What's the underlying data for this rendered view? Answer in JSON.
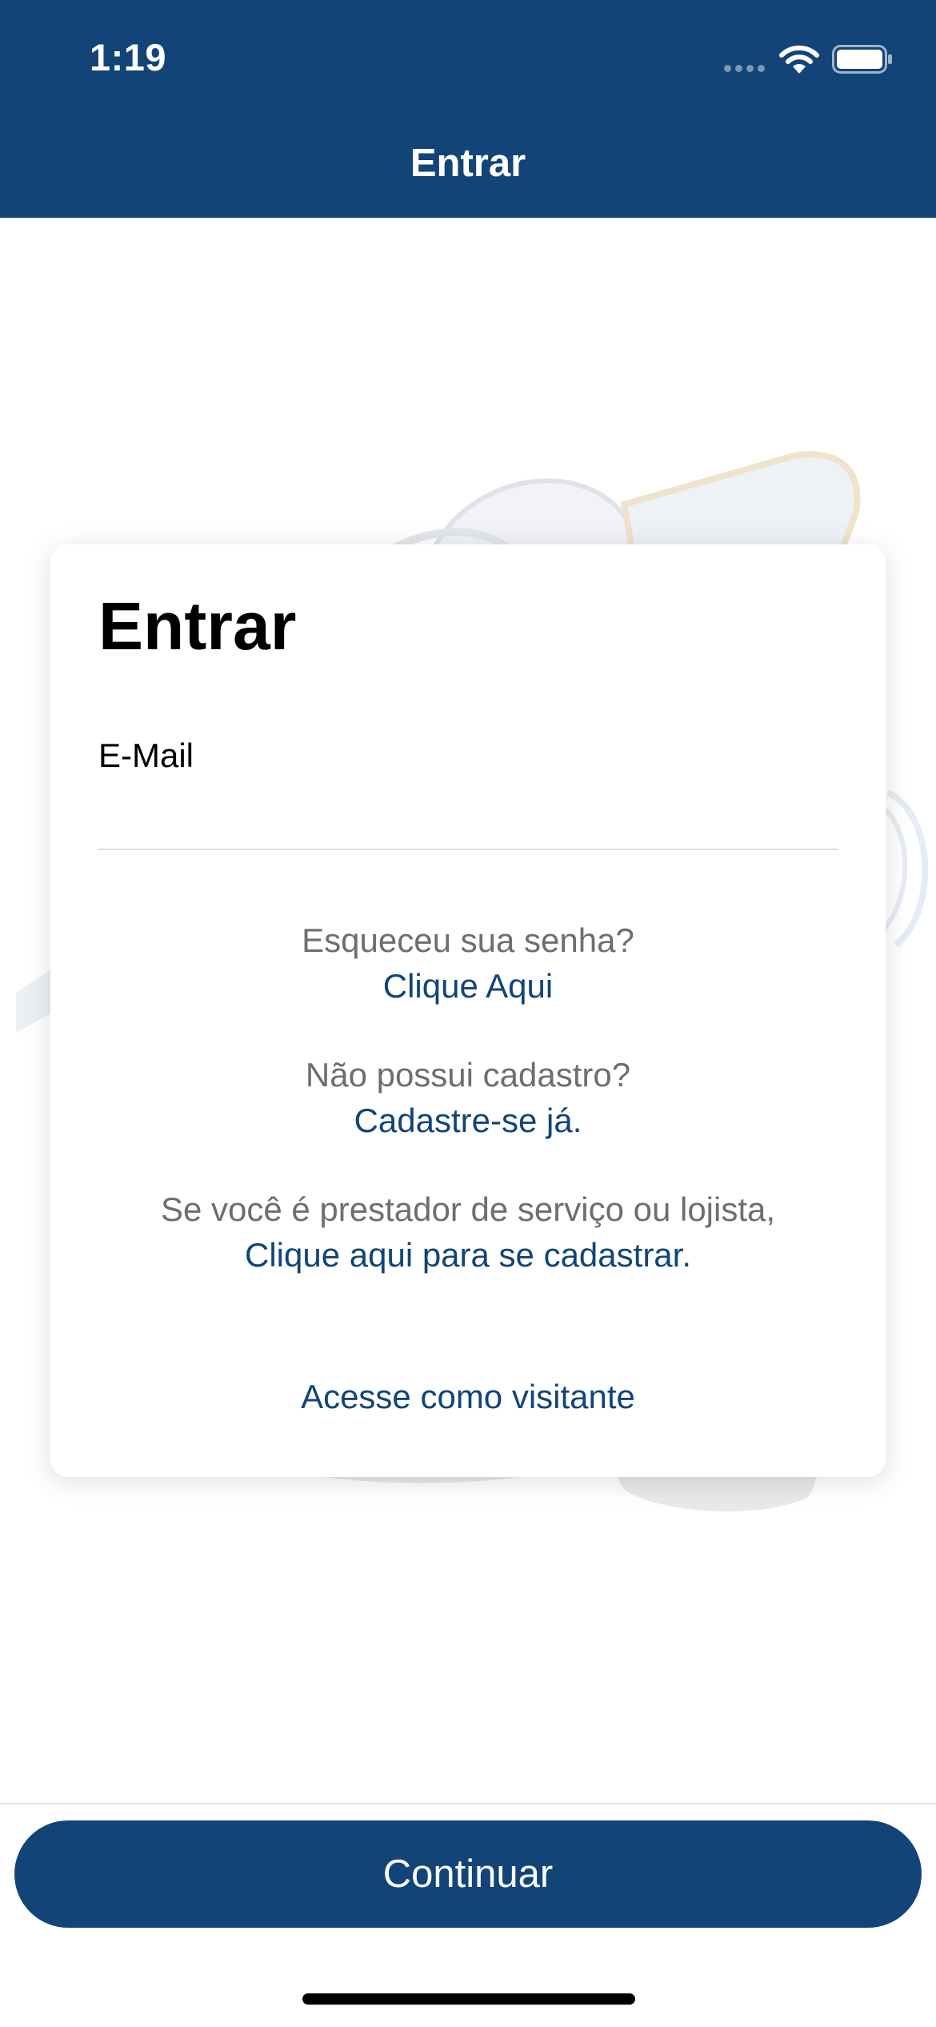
{
  "status_bar": {
    "time": "1:19",
    "icons": [
      "signal-icon",
      "wifi-icon",
      "battery-icon"
    ]
  },
  "header": {
    "title": "Entrar"
  },
  "card": {
    "title": "Entrar",
    "email_label": "E-Mail",
    "email_value": "",
    "forgot_password_text": "Esqueceu sua senha?",
    "forgot_password_link": "Clique Aqui",
    "no_account_text": "Não possui cadastro?",
    "register_link": "Cadastre-se já.",
    "provider_text": "Se você é prestador de serviço ou lojista,",
    "provider_link": "Clique aqui para se cadastrar.",
    "visitor_link": "Acesse como visitante"
  },
  "footer": {
    "continue_label": "Continuar"
  },
  "colors": {
    "brand": "#124478",
    "muted_text": "#6e6e6e",
    "background": "#ffffff"
  }
}
